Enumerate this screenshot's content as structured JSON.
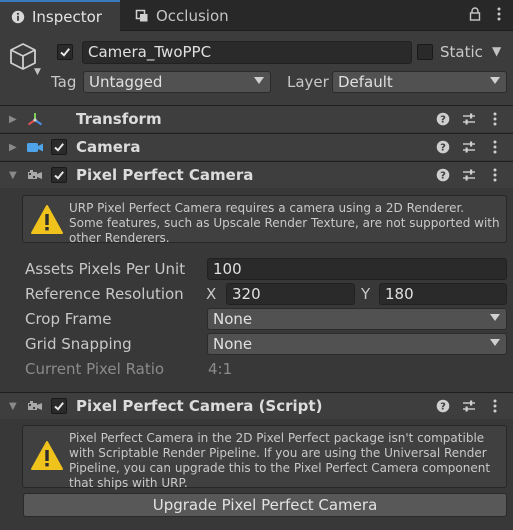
{
  "tabs": {
    "inspector": "Inspector",
    "occlusion": "Occlusion"
  },
  "header": {
    "object_name": "Camera_TwoPPC",
    "active": true,
    "static_label": "Static",
    "static_checked": false,
    "tag_label": "Tag",
    "tag_value": "Untagged",
    "layer_label": "Layer",
    "layer_value": "Default"
  },
  "components": {
    "transform": {
      "title": "Transform"
    },
    "camera": {
      "title": "Camera",
      "enabled": true
    },
    "ppc": {
      "title": "Pixel Perfect Camera",
      "enabled": true,
      "warning": "URP Pixel Perfect Camera requires a camera using a 2D Renderer. Some features, such as Upscale Render Texture, are not supported with other Renderers.",
      "assets_ppu_label": "Assets Pixels Per Unit",
      "assets_ppu_value": "100",
      "ref_res_label": "Reference Resolution",
      "x_label": "X",
      "x_value": "320",
      "y_label": "Y",
      "y_value": "180",
      "crop_frame_label": "Crop Frame",
      "crop_frame_value": "None",
      "grid_snapping_label": "Grid Snapping",
      "grid_snapping_value": "None",
      "current_ratio_label": "Current Pixel Ratio",
      "current_ratio_value": "4:1"
    },
    "ppc_script": {
      "title": "Pixel Perfect Camera (Script)",
      "enabled": true,
      "warning": "Pixel Perfect Camera in the 2D Pixel Perfect package isn't compatible with Scriptable Render Pipeline. If you are using the Universal Render Pipeline, you can upgrade this to the Pixel Perfect Camera component that ships with URP.",
      "upgrade_button": "Upgrade Pixel Perfect Camera"
    }
  },
  "colors": {
    "accent": "#3a79bb",
    "warning": "#f0c21c",
    "camera_icon": "#4fa3e8"
  }
}
